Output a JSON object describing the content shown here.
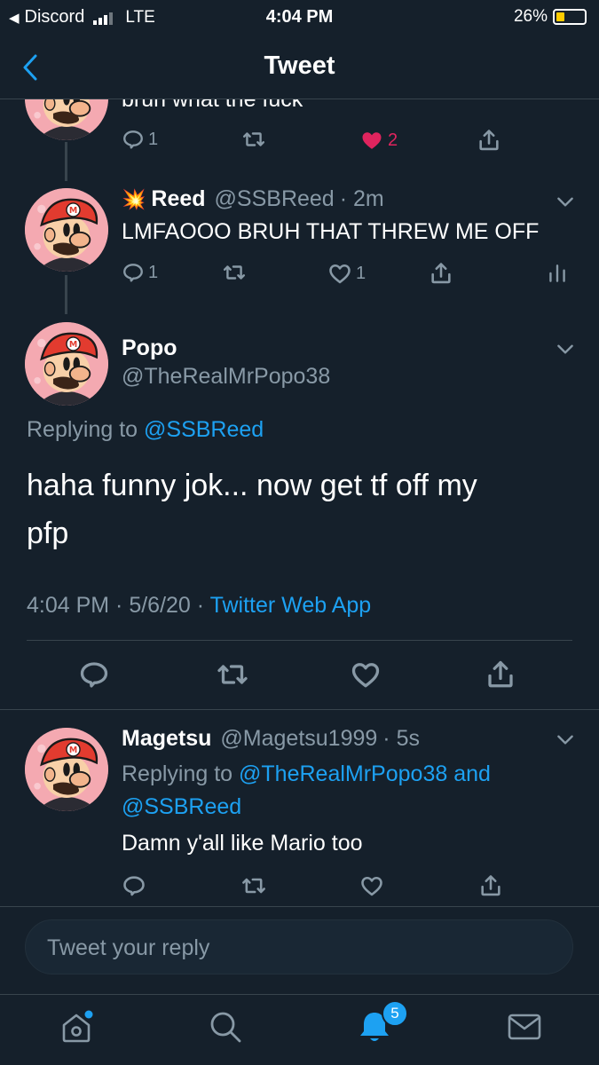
{
  "status_bar": {
    "back_app": "Discord",
    "network": "LTE",
    "time": "4:04 PM",
    "battery": "26%"
  },
  "nav": {
    "title": "Tweet"
  },
  "tweets": [
    {
      "text": "bruh what the fuck",
      "replies": "1",
      "likes": "2",
      "liked": true
    },
    {
      "emoji": "💥",
      "name": "Reed",
      "handle": "@SSBReed",
      "time": "· 2m",
      "text": "LMFAOOO BRUH THAT THREW ME OFF",
      "replies": "1",
      "likes": "1"
    }
  ],
  "main": {
    "name": "Popo",
    "handle": "@TheRealMrPopo38",
    "replying_prefix": "Replying to",
    "replying_to": "@SSBReed",
    "text_line1": "haha funny jok... now get tf off my",
    "text_line2": "pfp",
    "timestamp": "4:04 PM · 5/6/20 ·",
    "client": "Twitter Web App"
  },
  "reply": {
    "name": "Magetsu",
    "handle": "@Magetsu1999",
    "time": "· 5s",
    "replying_prefix": "Replying to",
    "replying_to_1": "@TheRealMrPopo38",
    "and": "and",
    "replying_to_2": "@SSBReed",
    "text": "Damn y'all like Mario too"
  },
  "composer": {
    "placeholder": "Tweet your reply"
  },
  "tabbar": {
    "notifications_badge": "5"
  },
  "colors": {
    "background": "#15202b",
    "accent": "#1da1f2",
    "muted": "#8899a6",
    "like": "#e0245e",
    "divider": "#38444d"
  },
  "icons": [
    "back-chevron-icon",
    "reply-icon",
    "retweet-icon",
    "heart-icon",
    "share-icon",
    "analytics-icon",
    "chevron-down-icon",
    "home-icon",
    "search-icon",
    "bell-icon",
    "mail-icon"
  ]
}
